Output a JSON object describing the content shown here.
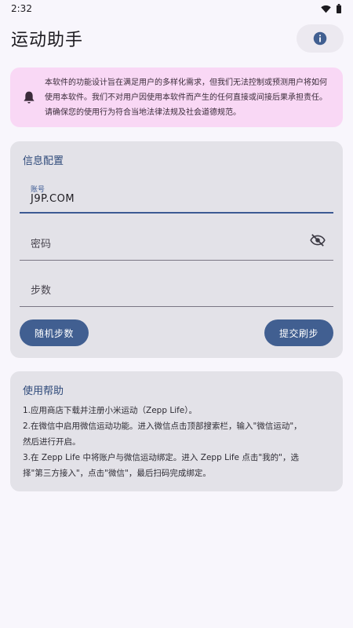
{
  "status_bar": {
    "time": "2:32"
  },
  "header": {
    "title": "运动助手"
  },
  "notice": {
    "text": "本软件的功能设计旨在满足用户的多样化需求，但我们无法控制或预测用户将如何使用本软件。我们不对用户因使用本软件而产生的任何直接或间接后果承担责任。请确保您的使用行为符合当地法律法规及社会道德规范。"
  },
  "config": {
    "title": "信息配置",
    "account_label": "账号",
    "account_value": "J9P.COM",
    "password_placeholder": "密码",
    "steps_placeholder": "步数",
    "random_button": "随机步数",
    "submit_button": "提交刷步"
  },
  "help": {
    "title": "使用帮助",
    "step1": "1.应用商店下载并注册小米运动（Zepp Life）。",
    "step2a": "2.在微信中启用微信运动功能。进入微信点击顶部搜索栏，输入\"微信运动\"，",
    "step2b": "然后进行开启。",
    "step3a": "3.在 Zepp Life 中将账户与微信运动绑定。进入 Zepp Life 点击\"我的\"，选",
    "step3b": "择\"第三方接入\"，点击\"微信\"，最后扫码完成绑定。"
  },
  "colors": {
    "accent": "#415f91",
    "notice_bg": "#f9d8f5",
    "card_bg": "#e3e2e8"
  },
  "icons": [
    "wifi-icon",
    "battery-icon",
    "info-icon",
    "bell-icon",
    "eye-off-icon"
  ]
}
